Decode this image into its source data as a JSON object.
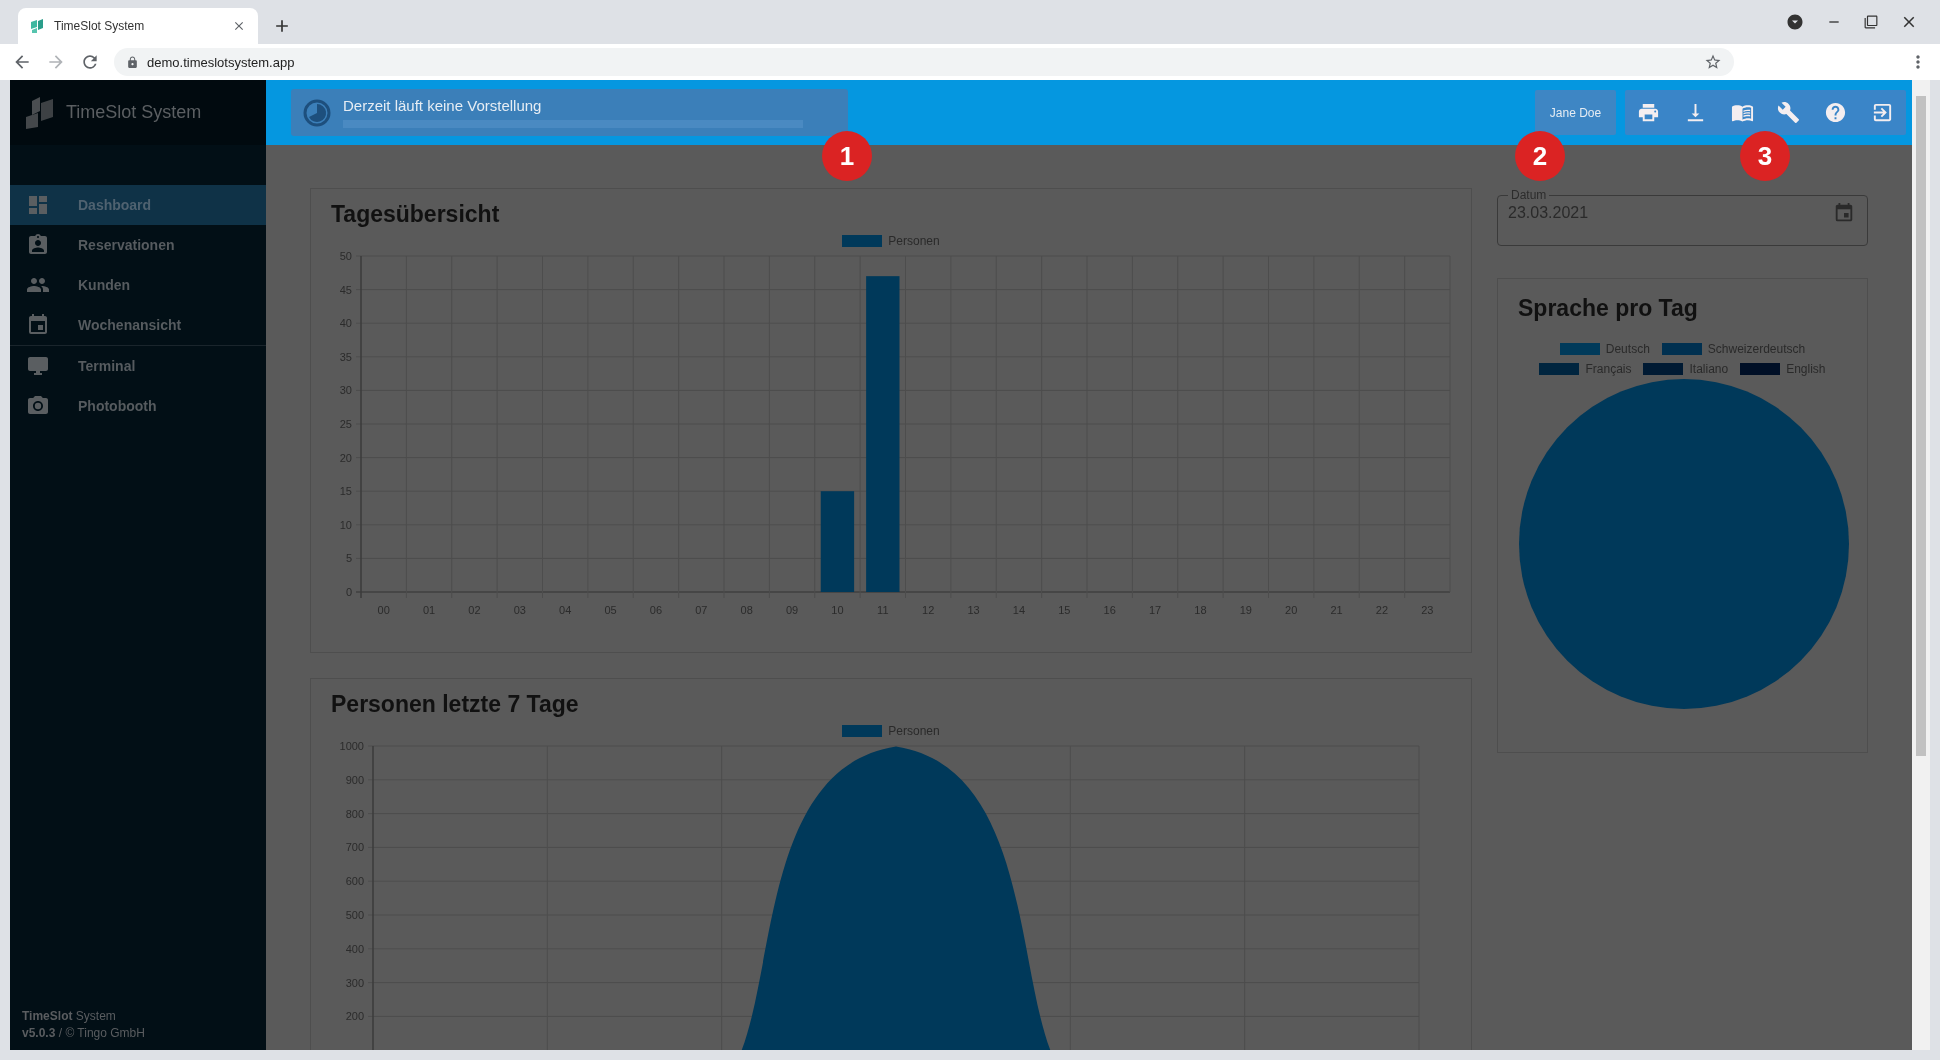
{
  "browser": {
    "tab_title": "TimeSlot System",
    "url": "demo.timeslotsystem.app"
  },
  "sidebar": {
    "app_name": "TimeSlot System",
    "groups": [
      [
        {
          "label": "Dashboard",
          "selected": true
        },
        {
          "label": "Reservationen",
          "selected": false
        },
        {
          "label": "Kunden",
          "selected": false
        },
        {
          "label": "Wochenansicht",
          "selected": false
        }
      ],
      [
        {
          "label": "Terminal",
          "selected": false
        },
        {
          "label": "Photobooth",
          "selected": false
        }
      ]
    ],
    "footer": [
      "**TimeSlot** System",
      "**v5.0.3** / © Tingo GmbH"
    ]
  },
  "header": {
    "status": "Derzeit läuft keine Vorstellung",
    "progress": {
      "level": 0
    },
    "user": "Jane Doe"
  },
  "callouts": [
    "1",
    "2",
    "3"
  ],
  "daily_card": {
    "title": "Tagesübersicht",
    "chart_data": {
      "type": "bar",
      "categories": [
        "00",
        "01",
        "02",
        "03",
        "04",
        "05",
        "06",
        "07",
        "08",
        "09",
        "10",
        "11",
        "12",
        "13",
        "14",
        "15",
        "16",
        "17",
        "18",
        "19",
        "20",
        "21",
        "22",
        "23"
      ],
      "series": [
        {
          "name": "Personen",
          "color": "#00395a",
          "values": [
            0,
            0,
            0,
            0,
            0,
            0,
            0,
            0,
            0,
            0,
            15,
            47,
            0,
            0,
            0,
            0,
            0,
            0,
            0,
            0,
            0,
            0,
            0,
            0
          ]
        }
      ],
      "ylim": [
        0,
        50
      ],
      "yticks": [
        0,
        5,
        10,
        15,
        20,
        25,
        30,
        35,
        40,
        45,
        50
      ],
      "grid": true
    }
  },
  "weekly_card": {
    "title": "Personen letzte 7 Tage",
    "legend": [
      {
        "name": "Personen",
        "color": "#00395a"
      }
    ],
    "y_axis_labels": [
      "1000",
      "900",
      "800",
      "700",
      "600",
      "500",
      "400",
      "300",
      "200"
    ]
  },
  "date_field": {
    "label": "Datum",
    "value": "23.03.2021"
  },
  "language_card": {
    "title": "Sprache pro Tag",
    "legend": [
      {
        "name": "Deutsch",
        "color": "#003a5a"
      },
      {
        "name": "Schweizerdeutsch",
        "color": "#003050"
      },
      {
        "name": "Français",
        "color": "#00253f"
      },
      {
        "name": "Italiano",
        "color": "#001a33"
      },
      {
        "name": "English",
        "color": "#000f26"
      }
    ]
  }
}
